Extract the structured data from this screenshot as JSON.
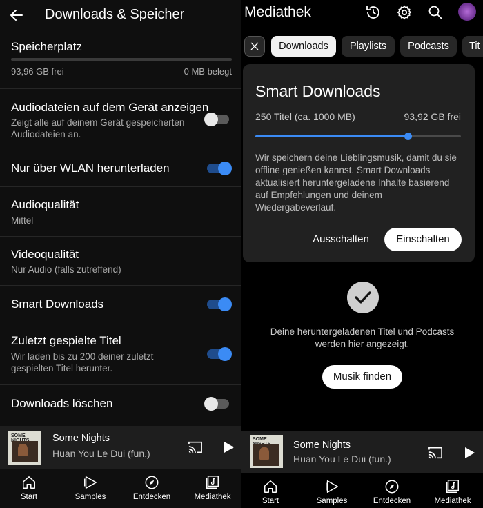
{
  "left": {
    "header": {
      "title": "Downloads & Speicher",
      "back_icon": "arrow-left-icon"
    },
    "storage": {
      "label": "Speicherplatz",
      "free": "93,96 GB frei",
      "used": "0 MB belegt"
    },
    "settings": [
      {
        "title": "Audiodateien auf dem Gerät anzeigen",
        "subtitle": "Zeigt alle auf deinem Gerät gespeicherten Audiodateien an.",
        "toggle": "off"
      },
      {
        "title": "Nur über WLAN herunterladen",
        "toggle": "on"
      },
      {
        "title": "Audioqualität",
        "subtitle": "Mittel"
      },
      {
        "title": "Videoqualität",
        "subtitle": "Nur Audio (falls zutreffend)"
      },
      {
        "title": "Smart Downloads",
        "toggle": "on"
      },
      {
        "title": "Zuletzt gespielte Titel",
        "subtitle": "Wir laden bis zu 200 deiner zuletzt gespielten Titel herunter.",
        "toggle": "on"
      },
      {
        "title": "Downloads löschen",
        "toggle": "off"
      }
    ]
  },
  "right": {
    "header": {
      "title": "Mediathek",
      "icons": [
        "history-icon",
        "gear-icon",
        "search-icon",
        "avatar"
      ]
    },
    "chips": [
      "Downloads",
      "Playlists",
      "Podcasts",
      "Tit"
    ],
    "chips_close_icon": "close-icon",
    "smart_downloads": {
      "title": "Smart Downloads",
      "count": "250 Titel (ca. 1000 MB)",
      "free": "93,92 GB frei",
      "slider_fraction": 0.74,
      "description": "Wir speichern deine Lieblingsmusik, damit du sie offline genießen kannst. Smart Downloads aktualisiert heruntergeladene Inhalte basierend auf Empfehlungen und deinem Wiedergabeverlauf.",
      "off_label": "Ausschalten",
      "on_label": "Einschalten"
    },
    "empty_state": {
      "icon": "check-circle-icon",
      "text": "Deine heruntergeladenen Titel und Podcasts werden hier angezeigt.",
      "button": "Musik finden"
    }
  },
  "player": {
    "song": "Some Nights",
    "artist": "Huan You Le Dui (fun.)",
    "cover_text": "SOME NIGHTS",
    "cast_icon": "cast-icon",
    "play_icon": "play-icon"
  },
  "nav": [
    {
      "label": "Start",
      "icon": "home-icon"
    },
    {
      "label": "Samples",
      "icon": "samples-icon"
    },
    {
      "label": "Entdecken",
      "icon": "compass-icon"
    },
    {
      "label": "Mediathek",
      "icon": "library-icon"
    }
  ],
  "colors": {
    "accent": "#3b8bf5",
    "background": "#0f0f0f",
    "card": "#212121"
  }
}
